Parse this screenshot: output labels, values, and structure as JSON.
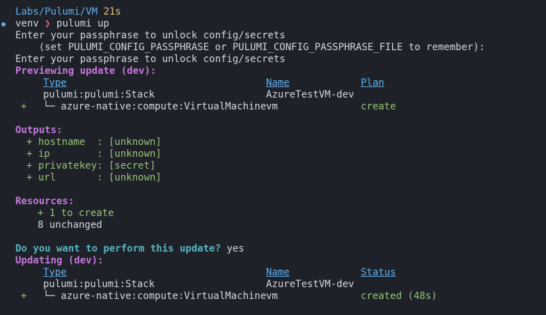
{
  "prompt": {
    "path": "Labs/Pulumi/VM",
    "duration": "21s",
    "venv": "venv",
    "arrow": "❯",
    "command": "pulumi up"
  },
  "messages": {
    "passphrase1": "Enter your passphrase to unlock config/secrets",
    "passphrase_hint": "    (set PULUMI_CONFIG_PASSPHRASE or PULUMI_CONFIG_PASSPHRASE_FILE to remember):",
    "passphrase2": "Enter your passphrase to unlock config/secrets"
  },
  "preview": {
    "heading": "Previewing update (dev):",
    "columns": {
      "type": "Type",
      "name": "Name",
      "plan": "Plan"
    },
    "rows": [
      {
        "marker": "",
        "type": "pulumi:pulumi:Stack",
        "name": "AzureTestVM-dev",
        "plan": ""
      },
      {
        "marker": "+",
        "type": "└─ azure-native:compute:VirtualMachine",
        "name": "vm",
        "plan": "create"
      }
    ]
  },
  "outputs": {
    "heading": "Outputs:",
    "items": [
      {
        "text": "+ hostname  : [unknown]"
      },
      {
        "text": "+ ip        : [unknown]"
      },
      {
        "text": "+ privatekey: [secret]"
      },
      {
        "text": "+ url       : [unknown]"
      }
    ]
  },
  "resources": {
    "heading": "Resources:",
    "to_create": "+ 1 to create",
    "unchanged": "8 unchanged"
  },
  "confirm": {
    "question": "Do you want to perform this update?",
    "answer": "yes"
  },
  "update": {
    "heading": "Updating (dev):",
    "columns": {
      "type": "Type",
      "name": "Name",
      "status": "Status"
    },
    "rows": [
      {
        "marker": "",
        "type": "pulumi:pulumi:Stack",
        "name": "AzureTestVM-dev",
        "status": ""
      },
      {
        "marker": "+",
        "type": "└─ azure-native:compute:VirtualMachine",
        "name": "vm",
        "status": "created (48s)"
      }
    ]
  },
  "colors": {
    "background": "#1e2127",
    "path": "#61afef",
    "duration": "#e5c07b",
    "heading": "#c678dd",
    "added": "#98c379",
    "question": "#56b6c2"
  }
}
